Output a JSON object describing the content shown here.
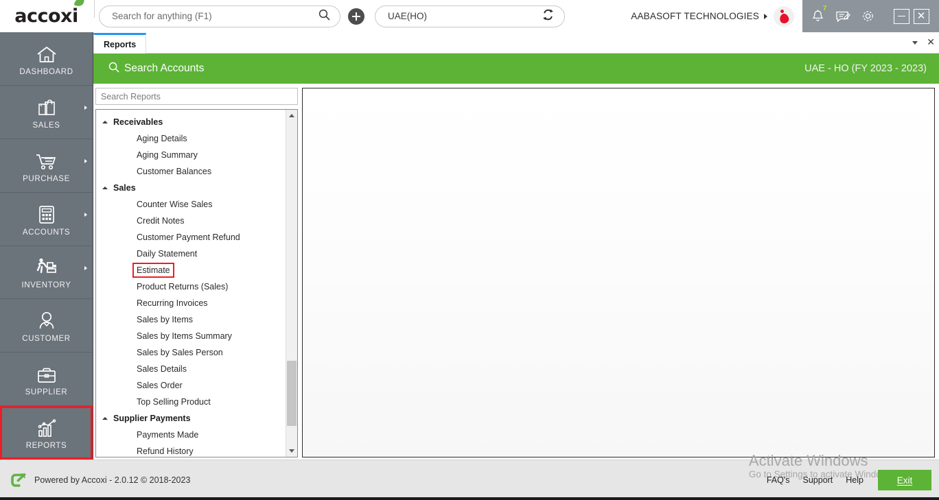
{
  "brand": {
    "name": "accoxi",
    "leaf_color": "#62b245"
  },
  "topbar": {
    "search": {
      "placeholder": "Search for anything (F1)",
      "value": ""
    },
    "add_button_label": "+",
    "branch": {
      "value": "UAE(HO)",
      "switch_icon": "sync-icon"
    },
    "organization": "AABASOFT TECHNOLOGIES",
    "notification_count": "7",
    "icons": [
      "bell-icon",
      "feedback-icon",
      "gear-icon"
    ],
    "window_controls": [
      "minimize",
      "close"
    ]
  },
  "tabstrip": {
    "tabs": [
      {
        "label": "Reports",
        "active": true
      }
    ],
    "caret": "chevron-down-icon",
    "close": "close-icon"
  },
  "sidebar": {
    "items": [
      {
        "label": "DASHBOARD",
        "icon": "home-icon",
        "has_arrow": false,
        "highlighted": false
      },
      {
        "label": "SALES",
        "icon": "bag-icon",
        "has_arrow": true,
        "highlighted": false
      },
      {
        "label": "PURCHASE",
        "icon": "cart-icon",
        "has_arrow": true,
        "highlighted": false
      },
      {
        "label": "ACCOUNTS",
        "icon": "calculator-icon",
        "has_arrow": true,
        "highlighted": false
      },
      {
        "label": "INVENTORY",
        "icon": "forklift-icon",
        "has_arrow": true,
        "highlighted": false
      },
      {
        "label": "CUSTOMER",
        "icon": "person-icon",
        "has_arrow": false,
        "highlighted": false
      },
      {
        "label": "SUPPLIER",
        "icon": "briefcase-icon",
        "has_arrow": false,
        "highlighted": false
      },
      {
        "label": "REPORTS",
        "icon": "chart-icon",
        "has_arrow": false,
        "highlighted": true
      }
    ],
    "highlight_color": "#ee1c24"
  },
  "green_bar": {
    "title": "Search Accounts",
    "icon": "search-icon",
    "right_label": "UAE - HO (FY 2023 - 2023)",
    "color": "#5cb335"
  },
  "report_search": {
    "placeholder": "Search Reports",
    "value": ""
  },
  "tree": {
    "highlight_color": "#ee1c24",
    "groups": [
      {
        "label": "Receivables",
        "expanded": true,
        "items": [
          {
            "label": "Aging Details",
            "highlighted": false
          },
          {
            "label": "Aging Summary",
            "highlighted": false
          },
          {
            "label": "Customer Balances",
            "highlighted": false
          }
        ]
      },
      {
        "label": "Sales",
        "expanded": true,
        "items": [
          {
            "label": "Counter Wise Sales",
            "highlighted": false
          },
          {
            "label": "Credit Notes",
            "highlighted": false
          },
          {
            "label": "Customer Payment Refund",
            "highlighted": false
          },
          {
            "label": "Daily Statement",
            "highlighted": false
          },
          {
            "label": "Estimate",
            "highlighted": true
          },
          {
            "label": "Product Returns (Sales)",
            "highlighted": false
          },
          {
            "label": "Recurring Invoices",
            "highlighted": false
          },
          {
            "label": "Sales by Items",
            "highlighted": false
          },
          {
            "label": "Sales by Items Summary",
            "highlighted": false
          },
          {
            "label": "Sales by Sales Person",
            "highlighted": false
          },
          {
            "label": "Sales Details",
            "highlighted": false
          },
          {
            "label": "Sales Order",
            "highlighted": false
          },
          {
            "label": "Top Selling Product",
            "highlighted": false
          }
        ]
      },
      {
        "label": "Supplier Payments",
        "expanded": true,
        "items": [
          {
            "label": "Payments Made",
            "highlighted": false
          },
          {
            "label": "Refund History",
            "highlighted": false
          }
        ]
      }
    ]
  },
  "footer": {
    "powered_by": "Powered by Accoxi - 2.0.12 © 2018-2023",
    "links": [
      "FAQ's",
      "Support",
      "Help"
    ],
    "exit_label": "Exit",
    "exit_color": "#5cb335"
  },
  "watermark": {
    "title": "Activate Windows",
    "subtitle": "Go to Settings to activate Windows."
  }
}
